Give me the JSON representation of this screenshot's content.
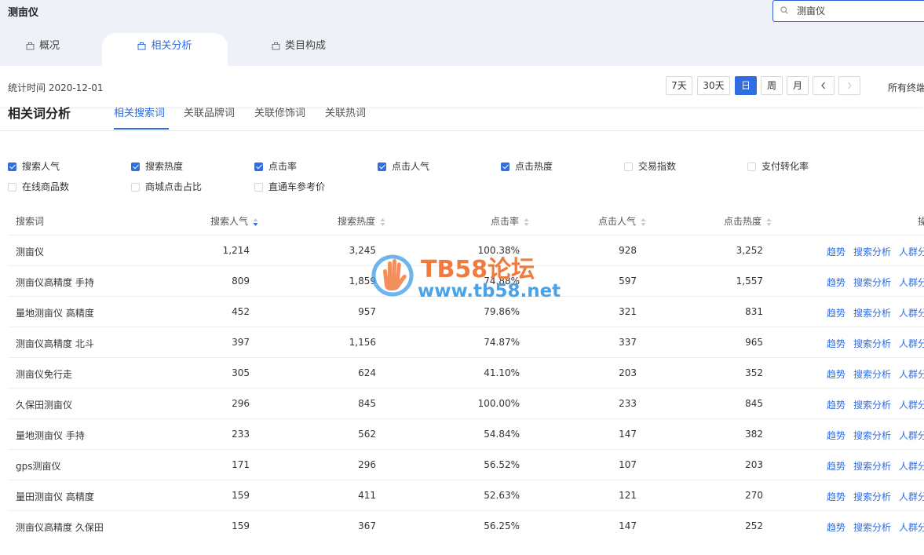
{
  "app_title": "测亩仪",
  "search": {
    "value": "测亩仪",
    "icon": "search-icon"
  },
  "tabs": [
    {
      "label": "概况",
      "icon": "bag-icon",
      "active": false
    },
    {
      "label": "相关分析",
      "icon": "bag-icon",
      "active": true
    },
    {
      "label": "类目构成",
      "icon": "bag-icon",
      "active": false
    }
  ],
  "toolbar": {
    "stat_time": "统计时间 2020-12-01",
    "ranges": [
      "7天",
      "30天",
      "日",
      "周",
      "月"
    ],
    "active_range": "日",
    "all_terms": "所有终端"
  },
  "section": {
    "title": "相关词分析",
    "subtabs": [
      "相关搜索词",
      "关联品牌词",
      "关联修饰词",
      "关联热词"
    ],
    "active_subtab": "相关搜索词"
  },
  "metrics": [
    {
      "label": "搜索人气",
      "checked": true
    },
    {
      "label": "搜索热度",
      "checked": true
    },
    {
      "label": "点击率",
      "checked": true
    },
    {
      "label": "点击人气",
      "checked": true
    },
    {
      "label": "点击热度",
      "checked": true
    },
    {
      "label": "交易指数",
      "checked": false
    },
    {
      "label": "支付转化率",
      "checked": false
    },
    {
      "label": "在线商品数",
      "checked": false
    },
    {
      "label": "商城点击占比",
      "checked": false
    },
    {
      "label": "直通车参考价",
      "checked": false
    }
  ],
  "table": {
    "columns": [
      "搜索词",
      "搜索人气",
      "搜索热度",
      "点击率",
      "点击人气",
      "点击热度",
      "操作"
    ],
    "actions": [
      "趋势",
      "搜索分析",
      "人群分析"
    ],
    "rows": [
      [
        "测亩仪",
        "1,214",
        "3,245",
        "100.38%",
        "928",
        "3,252"
      ],
      [
        "测亩仪高精度 手持",
        "809",
        "1,859",
        "74.88%",
        "597",
        "1,557"
      ],
      [
        "量地测亩仪 高精度",
        "452",
        "957",
        "79.86%",
        "321",
        "831"
      ],
      [
        "测亩仪高精度 北斗",
        "397",
        "1,156",
        "74.87%",
        "337",
        "965"
      ],
      [
        "测亩仪免行走",
        "305",
        "624",
        "41.10%",
        "203",
        "352"
      ],
      [
        "久保田测亩仪",
        "296",
        "845",
        "100.00%",
        "233",
        "845"
      ],
      [
        "量地测亩仪 手持",
        "233",
        "562",
        "54.84%",
        "147",
        "382"
      ],
      [
        "gps测亩仪",
        "171",
        "296",
        "56.52%",
        "107",
        "203"
      ],
      [
        "量田测亩仪 高精度",
        "159",
        "411",
        "52.63%",
        "121",
        "270"
      ],
      [
        "测亩仪高精度 久保田",
        "159",
        "367",
        "56.25%",
        "147",
        "252"
      ]
    ]
  },
  "watermark": {
    "title": "TB58论坛",
    "url": "www.tb58.net"
  },
  "colors": {
    "accent": "#2f6de1",
    "header_bg": "#eef1f7",
    "watermark_orange": "#f07b3f",
    "watermark_blue": "#4aa3e8"
  }
}
